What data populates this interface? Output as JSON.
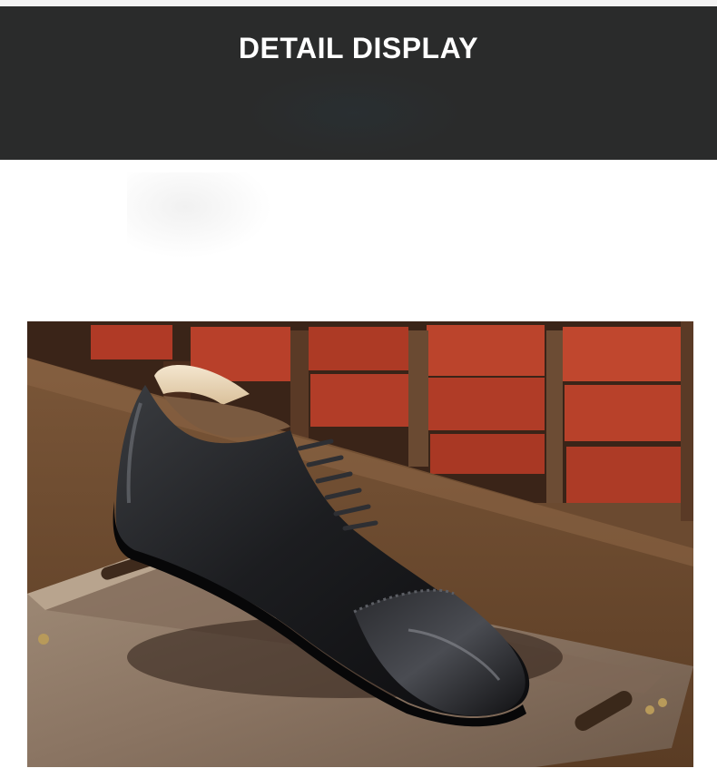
{
  "banner": {
    "title": "DETAIL DISPLAY"
  },
  "photo": {
    "subject": "black-leather-oxford-shoe-photo"
  },
  "colors": {
    "banner_bg": "#2a2b2b",
    "banner_text": "#ffffff",
    "page_bg": "#ffffff"
  }
}
